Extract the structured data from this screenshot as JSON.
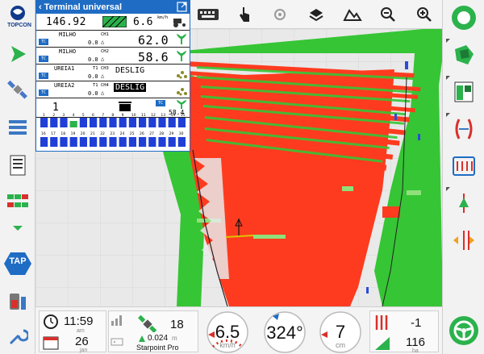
{
  "app": {
    "logo_text": "TOPCON"
  },
  "terminal": {
    "title": "Terminal universal",
    "row1": {
      "value_left": "146.92",
      "value_right": "6.6",
      "unit": "km/h"
    },
    "channels": [
      {
        "name": "MILHO",
        "ch": "CH1",
        "small": "0.0",
        "value": "62.0"
      },
      {
        "name": "MILHO",
        "ch": "CH2",
        "small": "0.0",
        "value": "58.6"
      },
      {
        "name": "UREIA1",
        "ch": "T1 CH3",
        "small": "0.0",
        "value": "DESLIG"
      },
      {
        "name": "UREIA2",
        "ch": "T1 CH4",
        "small": "0.0",
        "value": "DESLIG"
      }
    ],
    "row_bottom": {
      "left": "1",
      "right": "58.4"
    },
    "tc_label": "TC",
    "sections_top": [
      "1",
      "2",
      "3",
      "4",
      "5",
      "6",
      "7",
      "8",
      "9",
      "10",
      "11",
      "12",
      "13",
      "14",
      "15"
    ],
    "sections_bottom": [
      "16",
      "17",
      "18",
      "19",
      "20",
      "21",
      "22",
      "23",
      "24",
      "25",
      "26",
      "27",
      "28",
      "29",
      "30"
    ]
  },
  "status": {
    "time": "11:59",
    "time_suffix": "am",
    "date_day": "26",
    "date_month": "jan",
    "satellites": "18",
    "accuracy": "0.024",
    "accuracy_unit": "m",
    "correction": "Starpoint Pro",
    "speed": "6.5",
    "speed_unit": "km/h",
    "heading": "324°",
    "offset": "7",
    "offset_unit": "cm",
    "rows_value": "-1",
    "area_value": "116",
    "area_unit": "ha"
  },
  "buttons": {
    "tap_label": "TAP"
  },
  "colors": {
    "accent": "#1f6cc4",
    "field_red": "#ff3b1f",
    "field_green": "#36c535",
    "brand_green": "#2bb24c"
  }
}
